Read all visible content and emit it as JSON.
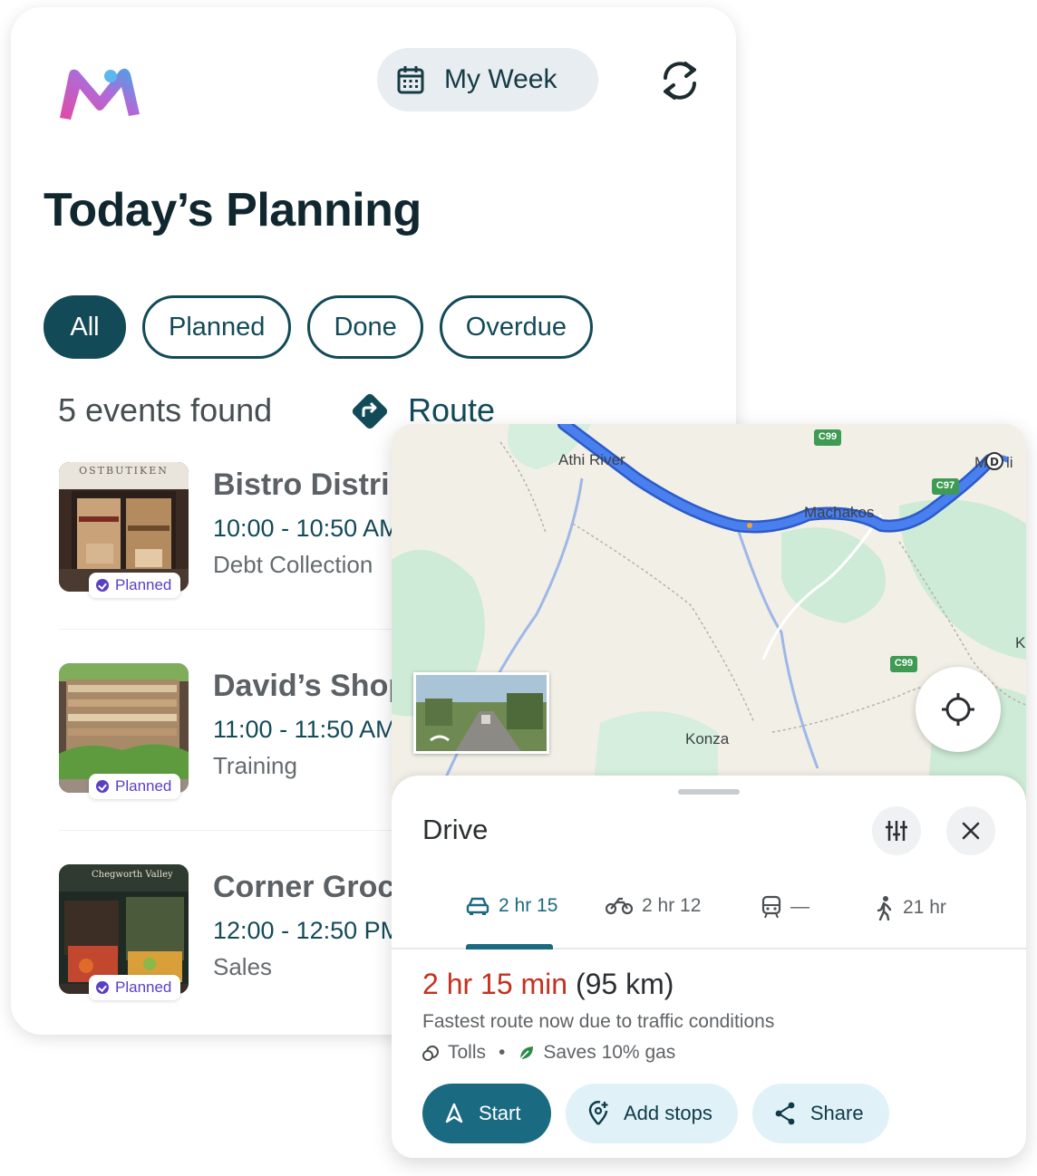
{
  "header": {
    "week_label": "My Week"
  },
  "page_title": "Today’s Planning",
  "filters": [
    {
      "label": "All",
      "active": true
    },
    {
      "label": "Planned",
      "active": false
    },
    {
      "label": "Done",
      "active": false
    },
    {
      "label": "Overdue",
      "active": false
    }
  ],
  "summary": {
    "events_found": "5 events found",
    "route_label": "Route"
  },
  "events": [
    {
      "name": "Bistro Distri",
      "time": "10:00 - 10:50 AM",
      "type": "Debt Collection",
      "status": "Planned",
      "thumb_text": "OSTBUTIKEN"
    },
    {
      "name": "David’s Shop",
      "time": "11:00 - 11:50 AM",
      "type": "Training",
      "status": "Planned"
    },
    {
      "name": "Corner Groc",
      "time": "12:00 - 12:50 PM",
      "type": "Sales",
      "status": "Planned",
      "thumb_text": "Chegworth Valley"
    }
  ],
  "map": {
    "labels": {
      "athi_river": "Athi River",
      "machakos": "Machakos",
      "konza": "Konza",
      "edge_top": "M",
      "edge_top_suffix": "ii",
      "edge_right": "K"
    },
    "roads": [
      "C99",
      "C97",
      "C99"
    ],
    "route_color": "#4a7ff0"
  },
  "directions": {
    "title": "Drive",
    "modes": [
      {
        "icon": "car-icon",
        "label": "2 hr 15",
        "active": true
      },
      {
        "icon": "motorcycle-icon",
        "label": "2 hr 12",
        "active": false
      },
      {
        "icon": "transit-icon",
        "label": "—",
        "active": false
      },
      {
        "icon": "walk-icon",
        "label": "21 hr",
        "active": false
      }
    ],
    "duration": "2 hr 15 min",
    "distance": "(95 km)",
    "description": "Fastest route now due to traffic conditions",
    "tolls": "Tolls",
    "savings": "Saves 10% gas",
    "buttons": {
      "start": "Start",
      "add_stops": "Add stops",
      "share": "Share"
    }
  },
  "colors": {
    "primary": "#134a58",
    "accent": "#1a6a82",
    "planned_badge": "#5a3fc4",
    "duration_red": "#c5301f"
  }
}
